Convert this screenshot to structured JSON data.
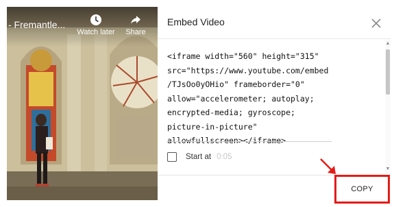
{
  "video": {
    "title": "- Fremantle...",
    "watch_later_label": "Watch later",
    "share_label": "Share"
  },
  "dialog": {
    "title": "Embed Video",
    "embed_code": "<iframe width=\"560\" height=\"315\"\nsrc=\"https://www.youtube.com/embed\n/TJsOo0yOHio\" frameborder=\"0\"\nallow=\"accelerometer; autoplay;\nencrypted-media; gyroscope;\npicture-in-picture\"\nallowfullscreen></iframe>",
    "start_at_label": "Start at",
    "start_at_time": "0:05",
    "start_at_checked": false,
    "copy_label": "COPY"
  },
  "annotation": {
    "highlight_color": "#e41b17"
  }
}
